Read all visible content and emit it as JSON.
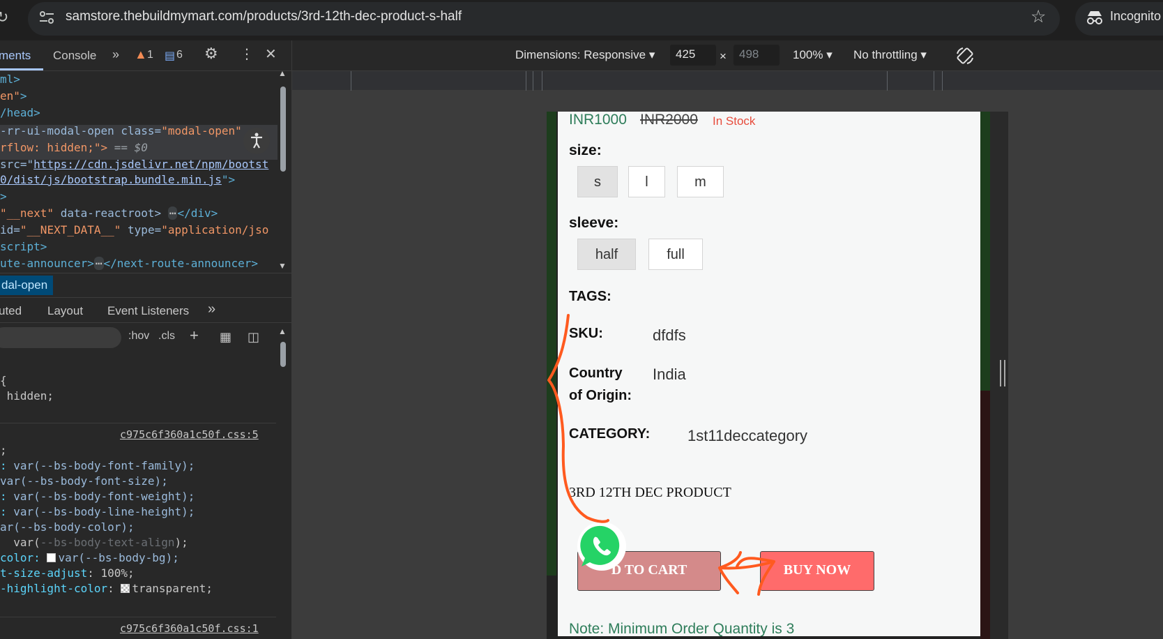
{
  "browser": {
    "url": "samstore.thebuildmymart.com/products/3rd-12th-dec-product-s-half",
    "incognito_label": "Incognito"
  },
  "devtools": {
    "tabs": [
      "ments",
      "Console"
    ],
    "warnings": "1",
    "messages": "6",
    "elements_lines": {
      "l1": "ml>",
      "l2_val": "en\"",
      "l2_end": ">",
      "l3": "/head>",
      "l4_a": "-rr-ui-modal-open class=",
      "l4_b": "\"modal-open\"",
      "l5_a": "rflow: hidden;\"> ",
      "l5_b": "== $0",
      "l6_a": "src=\"",
      "l6_b": "https://cdn.jsdelivr.net/npm/bootst",
      "l7_a": "0/dist/js/bootstrap.bundle.min.js",
      "l7_b": "\">",
      "l8": ">",
      "l9_a": "\"__next\"",
      "l9_b": " data-reactroot>",
      "l9_c": "</div>",
      "l10_a": "id=",
      "l10_b": "\"__NEXT_DATA__\"",
      "l10_c": " type=",
      "l10_d": "\"application/jso",
      "l11": "script>",
      "l12_a": "ute-announcer>",
      "l12_b": "</next-route-announcer>"
    },
    "breadcrumb": "dal-open",
    "sub_tabs": [
      "uted",
      "Layout",
      "Event Listeners"
    ],
    "filter_tools": [
      ":hov",
      ".cls"
    ],
    "styles": {
      "r1_a": "{",
      "r1_b": " hidden;",
      "source1": "c975c6f360a1c50f.css:5",
      "s1": ";",
      "s2_p": ": ",
      "s2_v": "var(--bs-body-font-family);",
      "s3_v": "var(--bs-body-font-size);",
      "s4_p": ": ",
      "s4_v": "var(--bs-body-font-weight);",
      "s5_p": ": ",
      "s5_v": "var(--bs-body-line-height);",
      "s6_p": "ar(--bs-body-color);",
      "s7_a": "var(",
      "s7_b": "--bs-body-text-align",
      "s7_c": ");",
      "s8_p": "color: ",
      "s8_v": "var(--bs-body-bg);",
      "s9_p": "t-size-adjust",
      "s9_v": ": 100%;",
      "s10_p": "-highlight-color",
      "s10_v": "transparent;",
      "source2": "c975c6f360a1c50f.css:1"
    }
  },
  "device_toolbar": {
    "dimensions": "Dimensions: Responsive",
    "width": "425",
    "height": "498",
    "times": "×",
    "zoom": "100%",
    "throttling": "No throttling"
  },
  "product": {
    "price": "INR1000",
    "old_price": "INR2000",
    "stock": "In Stock",
    "size_label": "size:",
    "sizes": [
      "s",
      "l",
      "m"
    ],
    "sleeve_label": "sleeve:",
    "sleeves": [
      "half",
      "full"
    ],
    "tags_label": "TAGS:",
    "sku_label": "SKU:",
    "sku_value": "dfdfs",
    "country_label_1": "Country",
    "country_label_2": "of Origin:",
    "country_value": "India",
    "category_label": "CATEGORY:",
    "category_value": "1st11deccategory",
    "product_name": "3RD 12TH DEC PRODUCT",
    "add_to_cart": "D TO CART",
    "buy_now": "BUY NOW",
    "note": "Note: Minimum Order Quantity is 3"
  },
  "colors": {
    "accent_green": "#2e7d5a",
    "in_stock_red": "#e74c3c",
    "buy_now_bg": "#ff6b6b",
    "annotation_orange": "#ff5a1f"
  }
}
